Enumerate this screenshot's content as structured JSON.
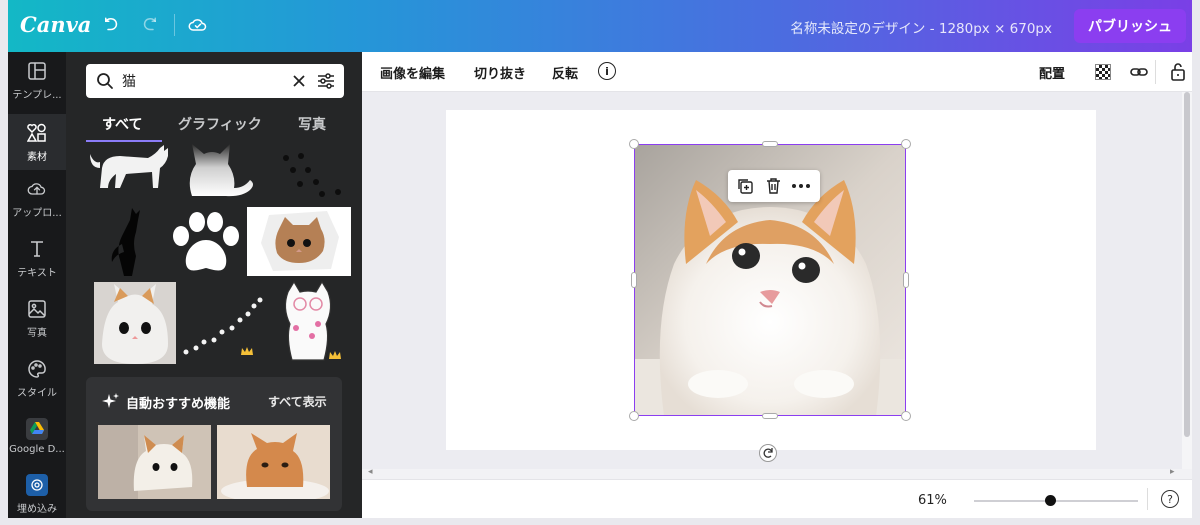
{
  "topbar": {
    "logo": "Canva",
    "doc_title": "名称未設定のデザイン - 1280px × 670px",
    "publish_label": "パブリッシュ"
  },
  "rail": {
    "items": [
      {
        "label": "テンプレ...",
        "icon": "template-icon"
      },
      {
        "label": "素材",
        "icon": "elements-icon"
      },
      {
        "label": "アップロ...",
        "icon": "upload-cloud-icon"
      },
      {
        "label": "テキスト",
        "icon": "text-icon"
      },
      {
        "label": "写真",
        "icon": "photo-icon"
      },
      {
        "label": "スタイル",
        "icon": "palette-icon"
      },
      {
        "label": "Google D...",
        "icon": "google-drive-icon"
      },
      {
        "label": "埋め込み",
        "icon": "embed-icon"
      }
    ]
  },
  "panel": {
    "search_value": "猫",
    "tabs": [
      "すべて",
      "グラフィック",
      "写真"
    ],
    "reco_title": "自動おすすめ機能",
    "reco_all": "すべて表示"
  },
  "edit_bar": {
    "edit_image": "画像を編集",
    "crop": "切り抜き",
    "flip": "反転",
    "arrange": "配置"
  },
  "zoom": {
    "percent": "61%",
    "level": 0.61
  },
  "colors": {
    "accent": "#8b3ef0",
    "rail_bg": "#18191b",
    "panel_bg": "#252627"
  }
}
